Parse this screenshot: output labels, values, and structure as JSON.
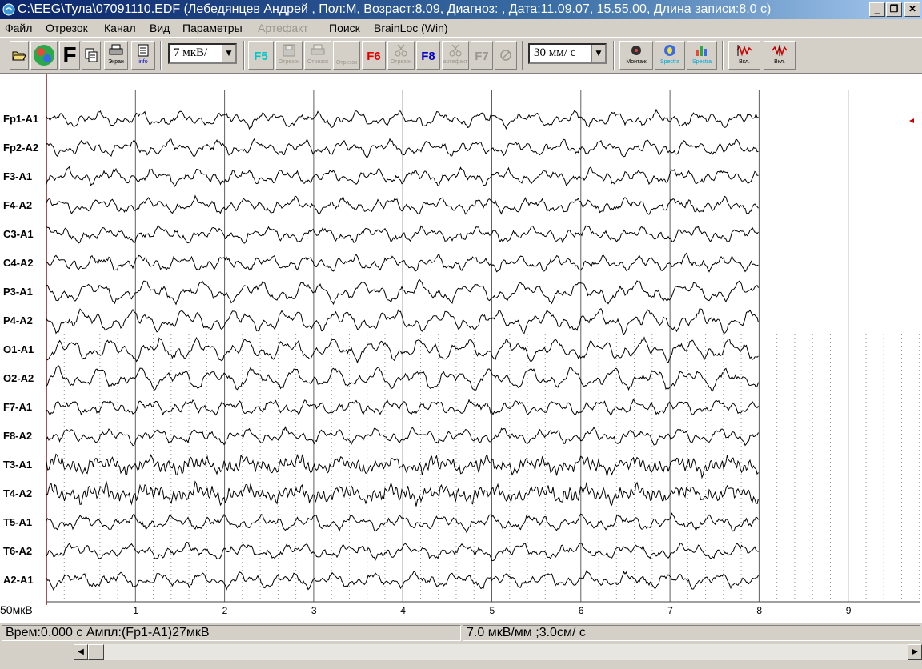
{
  "window": {
    "title": "C:\\EEG\\Тула\\07091110.EDF (Лебедянцев Андрей , Пол:М, Возраст:8.09, Диагноз: , Дата:11.09.07, 15.55.00, Длина записи:8.0 с)",
    "minimize": "_",
    "restore": "❐",
    "close": "✕"
  },
  "menu": {
    "items": [
      "Файл",
      "Отрезок",
      "Канал",
      "Вид",
      "Параметры",
      "Артефакт",
      "Поиск",
      "BrainLoc (Win)"
    ],
    "disabled": [
      "Артефакт"
    ]
  },
  "toolbar": {
    "open_icon": "folder-open-icon",
    "spectra_logo": "SPEC TRA",
    "font_button": "F",
    "copy_icon": "copy-icon",
    "print_screen_label": "Экран",
    "info_label": "info",
    "amplitude_value": "7 мкВ/",
    "f5_label": "F5",
    "save_segment_label": "Отрезок",
    "print_segment_label": "Отрезок",
    "segment3_label": "Отрезок",
    "f6_label": "F6",
    "f6_sub": "Отрезок",
    "f8_label": "F8",
    "f8_sub": "артефакт",
    "f7_label": "F7",
    "speed_value": "30 мм/ с",
    "montage_label": "Монтаж",
    "spectra_label": "Spectra",
    "spectra2_label": "Spectra",
    "on1_label": "Вкл.",
    "on2_label": "Вкл.",
    "colors": {
      "f5": "#00c8c8",
      "f6": "#e00000",
      "f8": "#0000c8",
      "f7": "#9a978f"
    }
  },
  "eeg": {
    "channels": [
      "Fp1-A1",
      "Fp2-A2",
      "F3-A1",
      "F4-A2",
      "C3-A1",
      "C4-A2",
      "P3-A1",
      "P4-A2",
      "O1-A1",
      "O2-A2",
      "F7-A1",
      "F8-A2",
      "T3-A1",
      "T4-A2",
      "T5-A1",
      "T6-A2",
      "A2-A1"
    ],
    "time_ticks": [
      "1",
      "2",
      "3",
      "4",
      "5",
      "6",
      "7",
      "8",
      "9"
    ],
    "scale_label": "50мкВ",
    "duration_s": 8.0
  },
  "status": {
    "left": "Врем:0.000 с Ампл:(Fp1-A1)27мкВ",
    "right": "7.0 мкВ/мм ;3.0см/ с"
  }
}
